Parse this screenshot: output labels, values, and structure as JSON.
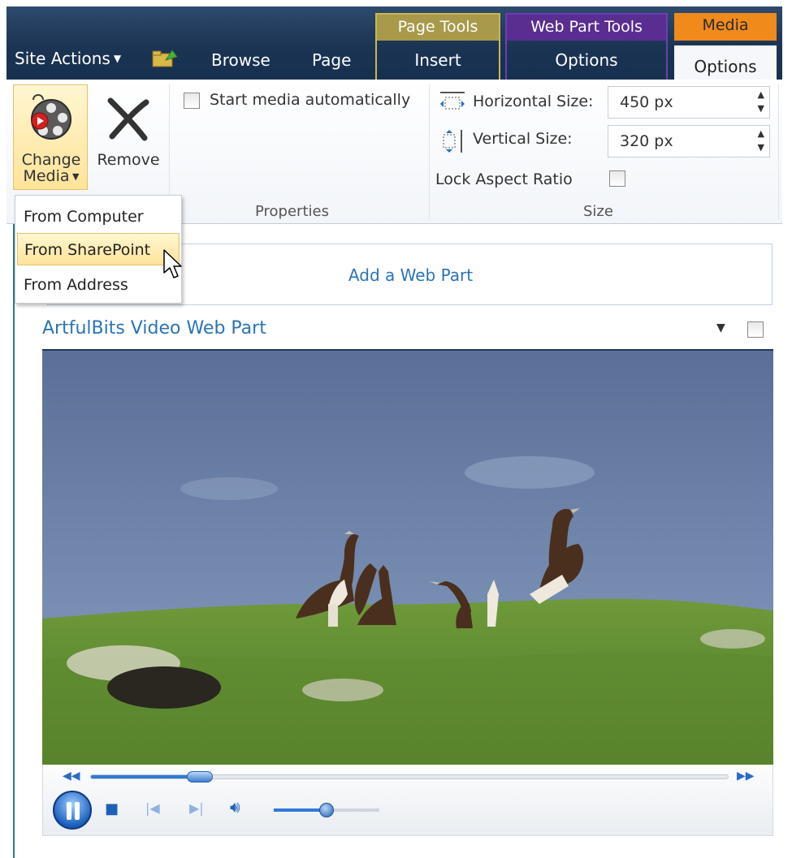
{
  "tabbar": {
    "site_actions": "Site Actions",
    "tabs": [
      "Browse",
      "Page"
    ],
    "contextual": {
      "page_tools": {
        "group": "Page Tools",
        "tab": "Insert"
      },
      "web_part_tools": {
        "group": "Web Part Tools",
        "tab": "Options"
      },
      "media": {
        "group": "Media",
        "tab": "Options"
      }
    }
  },
  "ribbon": {
    "change_media": {
      "line1": "Change",
      "line2": "Media"
    },
    "remove": "Remove",
    "start_automatically": "Start media automatically",
    "properties_label": "Properties",
    "horizontal_size": {
      "label": "Horizontal Size:",
      "value": "450 px"
    },
    "vertical_size": {
      "label": "Vertical Size:",
      "value": "320 px"
    },
    "lock_aspect": "Lock Aspect Ratio",
    "size_label": "Size"
  },
  "dropdown": {
    "items": [
      "From Computer",
      "From SharePoint",
      "From Address"
    ],
    "highlighted": 1
  },
  "page": {
    "add_web_part": "Add a Web Part",
    "web_part_title": "ArtfulBits Video Web Part"
  },
  "player": {
    "seek_fraction": 0.17,
    "volume_fraction": 0.5
  },
  "colors": {
    "ribbon_dark": "#1c3454",
    "page_tools": "#a89a4a",
    "web_part_tools": "#5a2d91",
    "media_accent": "#f08a1b",
    "link_blue": "#2a74b5",
    "player_blue": "#2f7ad8"
  }
}
